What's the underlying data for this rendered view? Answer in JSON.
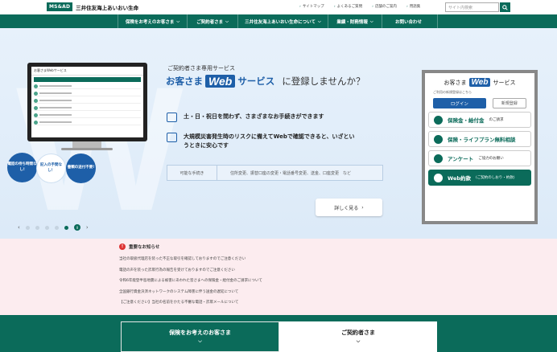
{
  "brand": {
    "logo_badge": "MS&AD",
    "company_name": "三井住友海上あいおい生命"
  },
  "utility_links": [
    "サイトマップ",
    "よくあるご質問",
    "店舗のご案内",
    "用語集"
  ],
  "search": {
    "placeholder": "サイト内検索"
  },
  "nav": {
    "items": [
      "保険をお考えのお客さま",
      "ご契約者さま",
      "三井住友海上あいおい生命について",
      "業績・財務情報",
      "お問い合わせ"
    ]
  },
  "hero": {
    "bg_letter": "W",
    "screen_title": "お客さまWebサービス",
    "bubbles": [
      "電話の待ち時間なし!",
      "記入の手間なし！",
      "書類の送付不要!"
    ],
    "subtitle": "ご契約者さま専用サービス",
    "headline_pre": "お客さま",
    "headline_web": "Web",
    "headline_post": "サービス",
    "headline_tail": "に登録しませんか？",
    "feature1": "土・日・祝日を問わず、さまざまなお手続きができます",
    "feature2": "大規模災害発生時のリスクに備えてWebで確認できると、いざというときに安心です",
    "procedures_label": "可能な手続き",
    "procedures_text": "住所変更、振替口座の変更・電話番号変更、送金、口座変更　など",
    "detail_button": "詳しく見る",
    "carousel_active_index": 5,
    "carousel_count": 6,
    "carousel_pause": "II"
  },
  "panel": {
    "title_pre": "お客さま",
    "title_web": "Web",
    "title_post": "サービス",
    "hint": "ご利用の新規登録はこちら",
    "login": "ログイン",
    "register": "新規登録",
    "btn_claim": "保険金・給付金",
    "btn_claim_sub": "のご請求",
    "btn_plan": "保険・ライフプラン無料相談",
    "btn_survey": "アンケート",
    "btn_survey_sub": "ご協力のお願い",
    "btn_web": "Web約款",
    "btn_web_sub": "(ご契約のしおり・約款)"
  },
  "news": {
    "header": "重要なお知らせ",
    "items": [
      "当社の取扱代理店を装った不正な取引を確認しておりますのでご注意ください",
      "電話の声を装った詐欺行為の報告を受けておりますのでご注意ください",
      "令和6年能登半島地震による被害にあわれた皆さまへの保険金・給付金のご請求について",
      "全国銀行資金決済ネットワークのシステム障害に伴う送金の遅延について",
      "【ご注意ください】当社の名前をかたる不審な電話・詐欺メールについて"
    ]
  },
  "bottom_tabs": [
    "保険をお考えのお客さま",
    "ご契約者さま"
  ],
  "colors": {
    "brand_green": "#0b6b5a",
    "accent_blue": "#1e5fa8",
    "news_bg": "#fcecef"
  }
}
